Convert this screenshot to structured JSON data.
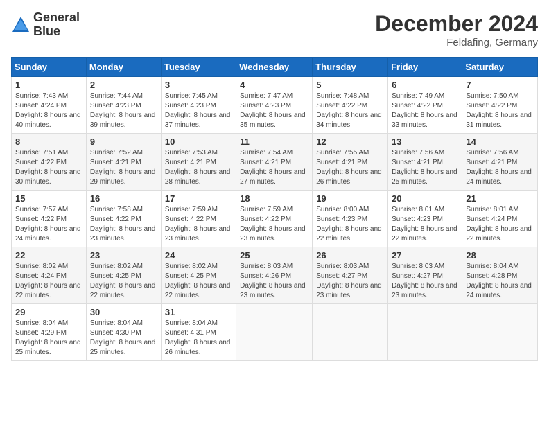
{
  "header": {
    "logo_line1": "General",
    "logo_line2": "Blue",
    "main_title": "December 2024",
    "subtitle": "Feldafing, Germany"
  },
  "calendar": {
    "days_of_week": [
      "Sunday",
      "Monday",
      "Tuesday",
      "Wednesday",
      "Thursday",
      "Friday",
      "Saturday"
    ],
    "weeks": [
      [
        {
          "num": "1",
          "sunrise": "7:43 AM",
          "sunset": "4:24 PM",
          "daylight": "8 hours and 40 minutes."
        },
        {
          "num": "2",
          "sunrise": "7:44 AM",
          "sunset": "4:23 PM",
          "daylight": "8 hours and 39 minutes."
        },
        {
          "num": "3",
          "sunrise": "7:45 AM",
          "sunset": "4:23 PM",
          "daylight": "8 hours and 37 minutes."
        },
        {
          "num": "4",
          "sunrise": "7:47 AM",
          "sunset": "4:23 PM",
          "daylight": "8 hours and 35 minutes."
        },
        {
          "num": "5",
          "sunrise": "7:48 AM",
          "sunset": "4:22 PM",
          "daylight": "8 hours and 34 minutes."
        },
        {
          "num": "6",
          "sunrise": "7:49 AM",
          "sunset": "4:22 PM",
          "daylight": "8 hours and 33 minutes."
        },
        {
          "num": "7",
          "sunrise": "7:50 AM",
          "sunset": "4:22 PM",
          "daylight": "8 hours and 31 minutes."
        }
      ],
      [
        {
          "num": "8",
          "sunrise": "7:51 AM",
          "sunset": "4:22 PM",
          "daylight": "8 hours and 30 minutes."
        },
        {
          "num": "9",
          "sunrise": "7:52 AM",
          "sunset": "4:21 PM",
          "daylight": "8 hours and 29 minutes."
        },
        {
          "num": "10",
          "sunrise": "7:53 AM",
          "sunset": "4:21 PM",
          "daylight": "8 hours and 28 minutes."
        },
        {
          "num": "11",
          "sunrise": "7:54 AM",
          "sunset": "4:21 PM",
          "daylight": "8 hours and 27 minutes."
        },
        {
          "num": "12",
          "sunrise": "7:55 AM",
          "sunset": "4:21 PM",
          "daylight": "8 hours and 26 minutes."
        },
        {
          "num": "13",
          "sunrise": "7:56 AM",
          "sunset": "4:21 PM",
          "daylight": "8 hours and 25 minutes."
        },
        {
          "num": "14",
          "sunrise": "7:56 AM",
          "sunset": "4:21 PM",
          "daylight": "8 hours and 24 minutes."
        }
      ],
      [
        {
          "num": "15",
          "sunrise": "7:57 AM",
          "sunset": "4:22 PM",
          "daylight": "8 hours and 24 minutes."
        },
        {
          "num": "16",
          "sunrise": "7:58 AM",
          "sunset": "4:22 PM",
          "daylight": "8 hours and 23 minutes."
        },
        {
          "num": "17",
          "sunrise": "7:59 AM",
          "sunset": "4:22 PM",
          "daylight": "8 hours and 23 minutes."
        },
        {
          "num": "18",
          "sunrise": "7:59 AM",
          "sunset": "4:22 PM",
          "daylight": "8 hours and 23 minutes."
        },
        {
          "num": "19",
          "sunrise": "8:00 AM",
          "sunset": "4:23 PM",
          "daylight": "8 hours and 22 minutes."
        },
        {
          "num": "20",
          "sunrise": "8:01 AM",
          "sunset": "4:23 PM",
          "daylight": "8 hours and 22 minutes."
        },
        {
          "num": "21",
          "sunrise": "8:01 AM",
          "sunset": "4:24 PM",
          "daylight": "8 hours and 22 minutes."
        }
      ],
      [
        {
          "num": "22",
          "sunrise": "8:02 AM",
          "sunset": "4:24 PM",
          "daylight": "8 hours and 22 minutes."
        },
        {
          "num": "23",
          "sunrise": "8:02 AM",
          "sunset": "4:25 PM",
          "daylight": "8 hours and 22 minutes."
        },
        {
          "num": "24",
          "sunrise": "8:02 AM",
          "sunset": "4:25 PM",
          "daylight": "8 hours and 22 minutes."
        },
        {
          "num": "25",
          "sunrise": "8:03 AM",
          "sunset": "4:26 PM",
          "daylight": "8 hours and 23 minutes."
        },
        {
          "num": "26",
          "sunrise": "8:03 AM",
          "sunset": "4:27 PM",
          "daylight": "8 hours and 23 minutes."
        },
        {
          "num": "27",
          "sunrise": "8:03 AM",
          "sunset": "4:27 PM",
          "daylight": "8 hours and 23 minutes."
        },
        {
          "num": "28",
          "sunrise": "8:04 AM",
          "sunset": "4:28 PM",
          "daylight": "8 hours and 24 minutes."
        }
      ],
      [
        {
          "num": "29",
          "sunrise": "8:04 AM",
          "sunset": "4:29 PM",
          "daylight": "8 hours and 25 minutes."
        },
        {
          "num": "30",
          "sunrise": "8:04 AM",
          "sunset": "4:30 PM",
          "daylight": "8 hours and 25 minutes."
        },
        {
          "num": "31",
          "sunrise": "8:04 AM",
          "sunset": "4:31 PM",
          "daylight": "8 hours and 26 minutes."
        },
        null,
        null,
        null,
        null
      ]
    ]
  }
}
